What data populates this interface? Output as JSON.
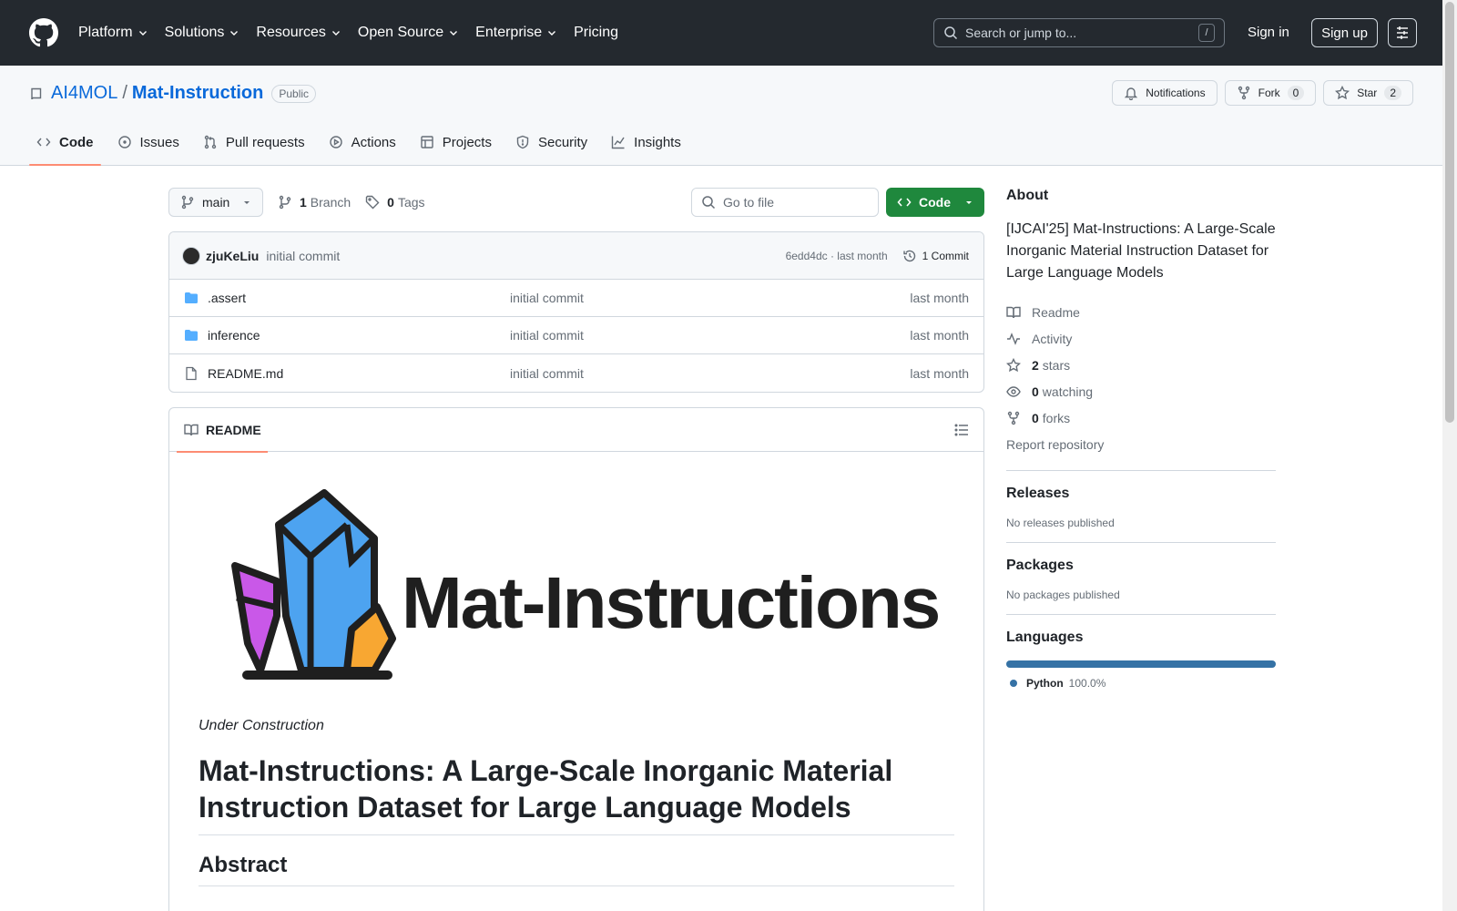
{
  "header": {
    "nav": [
      "Platform",
      "Solutions",
      "Resources",
      "Open Source",
      "Enterprise",
      "Pricing"
    ],
    "nav_has_menu": [
      true,
      true,
      true,
      true,
      true,
      false
    ],
    "search_placeholder": "Search or jump to...",
    "search_shortcut": "/",
    "signin": "Sign in",
    "signup": "Sign up"
  },
  "repo": {
    "owner": "AI4MOL",
    "separator": "/",
    "name": "Mat-Instruction",
    "visibility": "Public",
    "notifications": "Notifications",
    "fork": "Fork",
    "fork_count": "0",
    "star": "Star",
    "star_count": "2",
    "tabs": [
      {
        "label": "Code",
        "icon": "code-icon",
        "active": true
      },
      {
        "label": "Issues",
        "icon": "issue-icon",
        "active": false
      },
      {
        "label": "Pull requests",
        "icon": "pull-request-icon",
        "active": false
      },
      {
        "label": "Actions",
        "icon": "play-icon",
        "active": false
      },
      {
        "label": "Projects",
        "icon": "table-icon",
        "active": false
      },
      {
        "label": "Security",
        "icon": "shield-icon",
        "active": false
      },
      {
        "label": "Insights",
        "icon": "graph-icon",
        "active": false
      }
    ]
  },
  "toolbar": {
    "branch": "main",
    "branches_count": "1",
    "branches_label": "Branch",
    "tags_count": "0",
    "tags_label": "Tags",
    "goto_placeholder": "Go to file",
    "code_label": "Code"
  },
  "commit": {
    "author": "zjuKeLiu",
    "message": "initial commit",
    "hash_time": "6edd4dc · last month",
    "commits": "1 Commit"
  },
  "files": [
    {
      "name": ".assert",
      "type": "folder",
      "message": "initial commit",
      "date": "last month"
    },
    {
      "name": "inference",
      "type": "folder",
      "message": "initial commit",
      "date": "last month"
    },
    {
      "name": "README.md",
      "type": "file",
      "message": "initial commit",
      "date": "last month"
    }
  ],
  "readme": {
    "tab": "README",
    "logo_text": "Mat-Instructions",
    "status": "Under Construction",
    "title": "Mat-Instructions: A Large-Scale Inorganic Material Instruction Dataset for Large Language Models",
    "h2": "Abstract"
  },
  "about": {
    "title": "About",
    "description": "[IJCAI'25] Mat-Instructions: A Large-Scale Inorganic Material Instruction Dataset for Large Language Models",
    "readme": "Readme",
    "activity": "Activity",
    "stars_count": "2",
    "stars_label": "stars",
    "watching_count": "0",
    "watching_label": "watching",
    "forks_count": "0",
    "forks_label": "forks",
    "report": "Report repository"
  },
  "releases": {
    "title": "Releases",
    "empty": "No releases published"
  },
  "packages": {
    "title": "Packages",
    "empty": "No packages published"
  },
  "languages": {
    "title": "Languages",
    "items": [
      {
        "name": "Python",
        "percent": "100.0%",
        "color": "#3572A5"
      }
    ]
  },
  "colors": {
    "header_bg": "#24292f",
    "link": "#0969da",
    "primary_button": "#1f883d",
    "tab_underline": "#fd8c73"
  }
}
